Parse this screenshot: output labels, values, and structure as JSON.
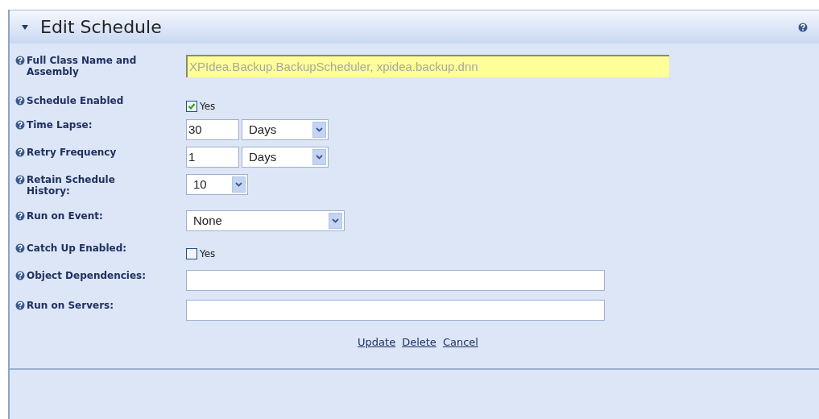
{
  "panel": {
    "title": "Edit Schedule",
    "expanded": true
  },
  "rows": [
    {
      "label": "Full Class Name and Assembly",
      "kind": "readonly-text",
      "value": "XPIdea.Backup.BackupScheduler, xpidea.backup.dnn"
    },
    {
      "label": "Schedule Enabled",
      "kind": "checkbox",
      "checked": true,
      "option": "Yes"
    },
    {
      "label": "Time Lapse:",
      "kind": "number-select",
      "value": "30",
      "unit": "Days"
    },
    {
      "label": "Retry Frequency",
      "kind": "number-select",
      "value": "1",
      "unit": "Days"
    },
    {
      "label": "Retain Schedule History:",
      "kind": "small-select",
      "value": "10"
    },
    {
      "label": "Run on Event:",
      "kind": "select",
      "value": "None"
    },
    {
      "label": "Catch Up Enabled:",
      "kind": "checkbox",
      "checked": false,
      "option": "Yes"
    },
    {
      "label": "Object Dependencies:",
      "kind": "text"
    },
    {
      "label": "Run on Servers:",
      "kind": "text"
    }
  ],
  "actions": [
    "Update",
    "Delete",
    "Cancel"
  ]
}
